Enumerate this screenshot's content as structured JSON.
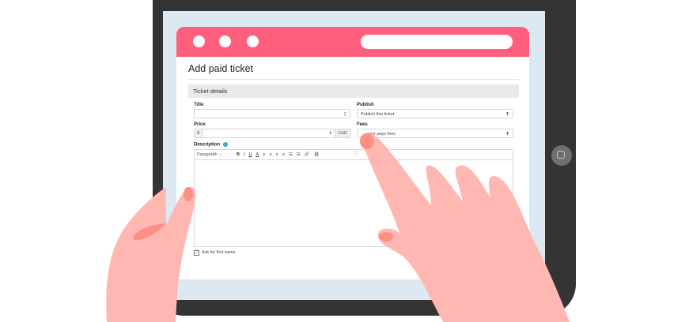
{
  "page_title": "Add paid ticket",
  "section_header": "Ticket details",
  "fields": {
    "title_label": "Title",
    "publish_label": "Publish",
    "publish_value": "Publish this ticket",
    "price_label": "Price",
    "price_prefix": "$",
    "price_currency": "CAD",
    "fees_label": "Fees",
    "fees_value": "izer pays fees",
    "description_label": "Description"
  },
  "toolbar": {
    "paragraph": "Paragraph",
    "bold": "B",
    "italic": "I",
    "underline": "U",
    "text_color": "A"
  },
  "checkbox_label": "Ask for first name",
  "colors": {
    "accent": "#fe5f7c",
    "skin": "#ffb8b1",
    "device": "#343434"
  }
}
